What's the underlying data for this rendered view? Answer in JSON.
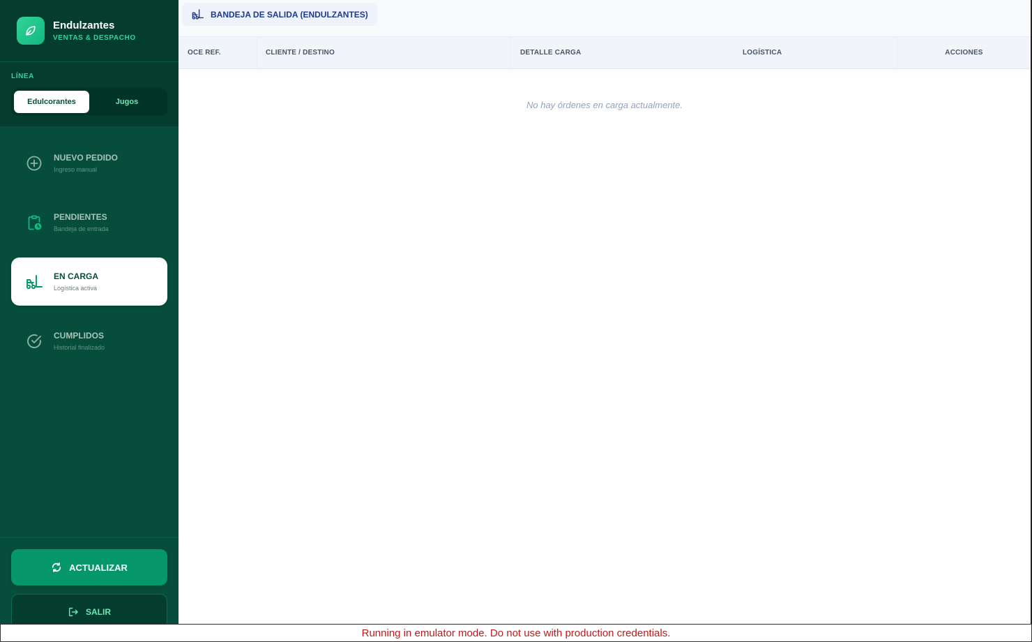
{
  "brand": {
    "title": "Endulzantes",
    "subtitle": "VENTAS & DESPACHO",
    "icon": "leaf-icon"
  },
  "line_selector": {
    "label": "LÍNEA",
    "options": [
      {
        "label": "Edulcorantes",
        "active": true
      },
      {
        "label": "Jugos",
        "active": false
      }
    ]
  },
  "nav": {
    "items": [
      {
        "title": "NUEVO PEDIDO",
        "subtitle": "Ingreso manual",
        "icon": "plus-circle-icon",
        "active": false
      },
      {
        "title": "PENDIENTES",
        "subtitle": "Bandeja de entrada",
        "icon": "clipboard-clock-icon",
        "active": false
      },
      {
        "title": "EN CARGA",
        "subtitle": "Logística activa",
        "icon": "forklift-icon",
        "active": true
      },
      {
        "title": "CUMPLIDOS",
        "subtitle": "Historial finalizado",
        "icon": "check-circle-icon",
        "active": false
      }
    ]
  },
  "footer": {
    "refresh_label": "ACTUALIZAR",
    "exit_label": "SALIR"
  },
  "main": {
    "tab_label": "BANDEJA DE SALIDA (ENDULZANTES)",
    "table": {
      "columns": [
        "OCE REF.",
        "CLIENTE / DESTINO",
        "DETALLE CARGA",
        "LOGÍSTICA",
        "ACCIONES"
      ],
      "rows": [],
      "empty_message": "No hay órdenes en carga actualmente."
    }
  },
  "emulator_notice": "Running in emulator mode. Do not use with production credentials.",
  "colors": {
    "sidebar_bg": "#064e3b",
    "accent": "#059669",
    "accent_light": "#34d399",
    "tab_text": "#1e3a8a",
    "warning_text": "#b91c1c"
  }
}
